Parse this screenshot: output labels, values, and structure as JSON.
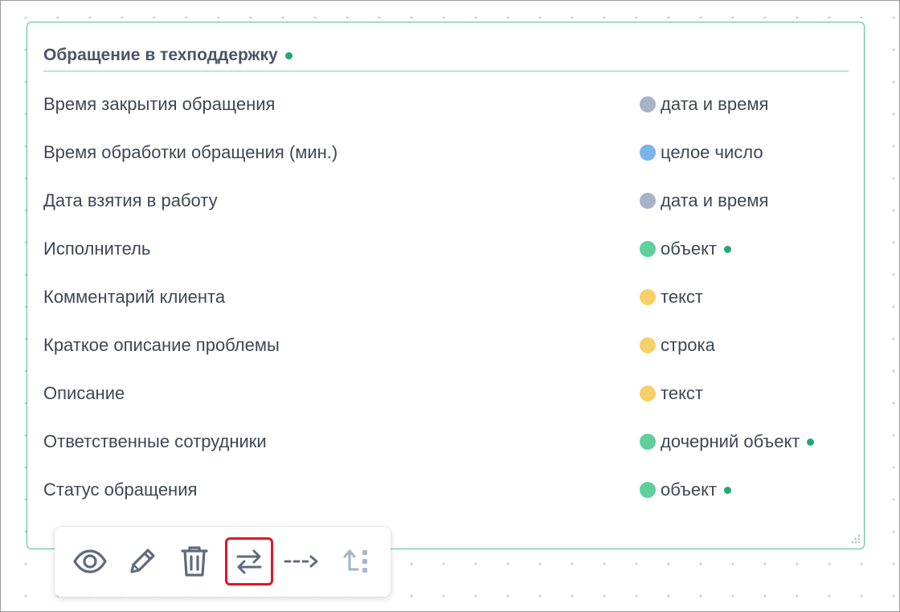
{
  "card": {
    "title": "Обращение в техподдержку",
    "fields": [
      {
        "name": "Время закрытия обращения",
        "type": "дата и время",
        "type_color": "#a7b4c6",
        "has_link": false
      },
      {
        "name": "Время обработки обращения (мин.)",
        "type": "целое число",
        "type_color": "#79b4ea",
        "has_link": false
      },
      {
        "name": "Дата взятия в работу",
        "type": "дата и время",
        "type_color": "#a7b4c6",
        "has_link": false
      },
      {
        "name": "Исполнитель",
        "type": "объект",
        "type_color": "#5fcf9d",
        "has_link": true
      },
      {
        "name": "Комментарий клиента",
        "type": "текст",
        "type_color": "#f7d06a",
        "has_link": false
      },
      {
        "name": "Краткое описание проблемы",
        "type": "строка",
        "type_color": "#f7d06a",
        "has_link": false
      },
      {
        "name": "Описание",
        "type": "текст",
        "type_color": "#f7d06a",
        "has_link": false
      },
      {
        "name": "Ответственные сотрудники",
        "type": "дочерний объект",
        "type_color": "#5fcf9d",
        "has_link": true
      },
      {
        "name": "Статус обращения",
        "type": "объект",
        "type_color": "#5fcf9d",
        "has_link": true
      }
    ]
  },
  "colors": {
    "card_border": "#4cc193",
    "link_dot": "#22a873",
    "icon": "#5f6b7e",
    "icon_light": "#a9b6c8",
    "selected_outline": "#e3142b"
  },
  "toolbar": {
    "buttons": [
      {
        "name": "view-button",
        "icon": "eye-icon",
        "selected": false
      },
      {
        "name": "edit-button",
        "icon": "pencil-icon",
        "selected": false
      },
      {
        "name": "delete-button",
        "icon": "trash-icon",
        "selected": false
      },
      {
        "name": "swap-button",
        "icon": "swap-arrows-icon",
        "selected": true
      },
      {
        "name": "link-button",
        "icon": "dashed-arrow-icon",
        "selected": false
      },
      {
        "name": "move-up-button",
        "icon": "arrow-up-dots-icon",
        "selected": false
      }
    ]
  }
}
